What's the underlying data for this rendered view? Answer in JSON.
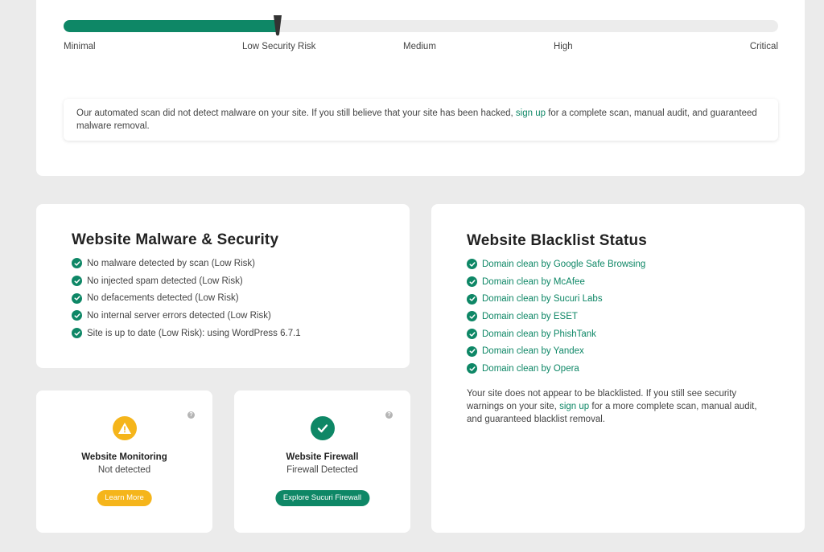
{
  "risk": {
    "level_fraction": 0.3,
    "labels": [
      "Minimal",
      "Low Security Risk",
      "Medium",
      "High",
      "Critical"
    ],
    "notice_before": "Our automated scan did not detect malware on your site. If you still believe that your site has been hacked, ",
    "notice_link": "sign up",
    "notice_after": " for a complete scan, manual audit, and guaranteed malware removal."
  },
  "malware": {
    "title": "Website Malware & Security",
    "items": [
      "No malware detected by scan (Low Risk)",
      "No injected spam detected (Low Risk)",
      "No defacements detected (Low Risk)",
      "No internal server errors detected (Low Risk)",
      "Site is up to date (Low Risk): using WordPress 6.7.1"
    ]
  },
  "blacklist": {
    "title": "Website Blacklist Status",
    "items": [
      "Domain clean by Google Safe Browsing",
      "Domain clean by McAfee",
      "Domain clean by Sucuri Labs",
      "Domain clean by ESET",
      "Domain clean by PhishTank",
      "Domain clean by Yandex",
      "Domain clean by Opera"
    ],
    "text_before": "Your site does not appear to be blacklisted. If you still see security warnings on your site, ",
    "text_link": "sign up",
    "text_after": " for a more complete scan, manual audit, and guaranteed blacklist removal."
  },
  "monitoring": {
    "title": "Website Monitoring",
    "status": "Not detected",
    "button": "Learn More",
    "help": "?"
  },
  "firewall": {
    "title": "Website Firewall",
    "status": "Firewall Detected",
    "button": "Explore Sucuri Firewall",
    "help": "?"
  },
  "colors": {
    "accent": "#0e8766",
    "warning": "#f5b51b",
    "background": "#ebebeb"
  }
}
